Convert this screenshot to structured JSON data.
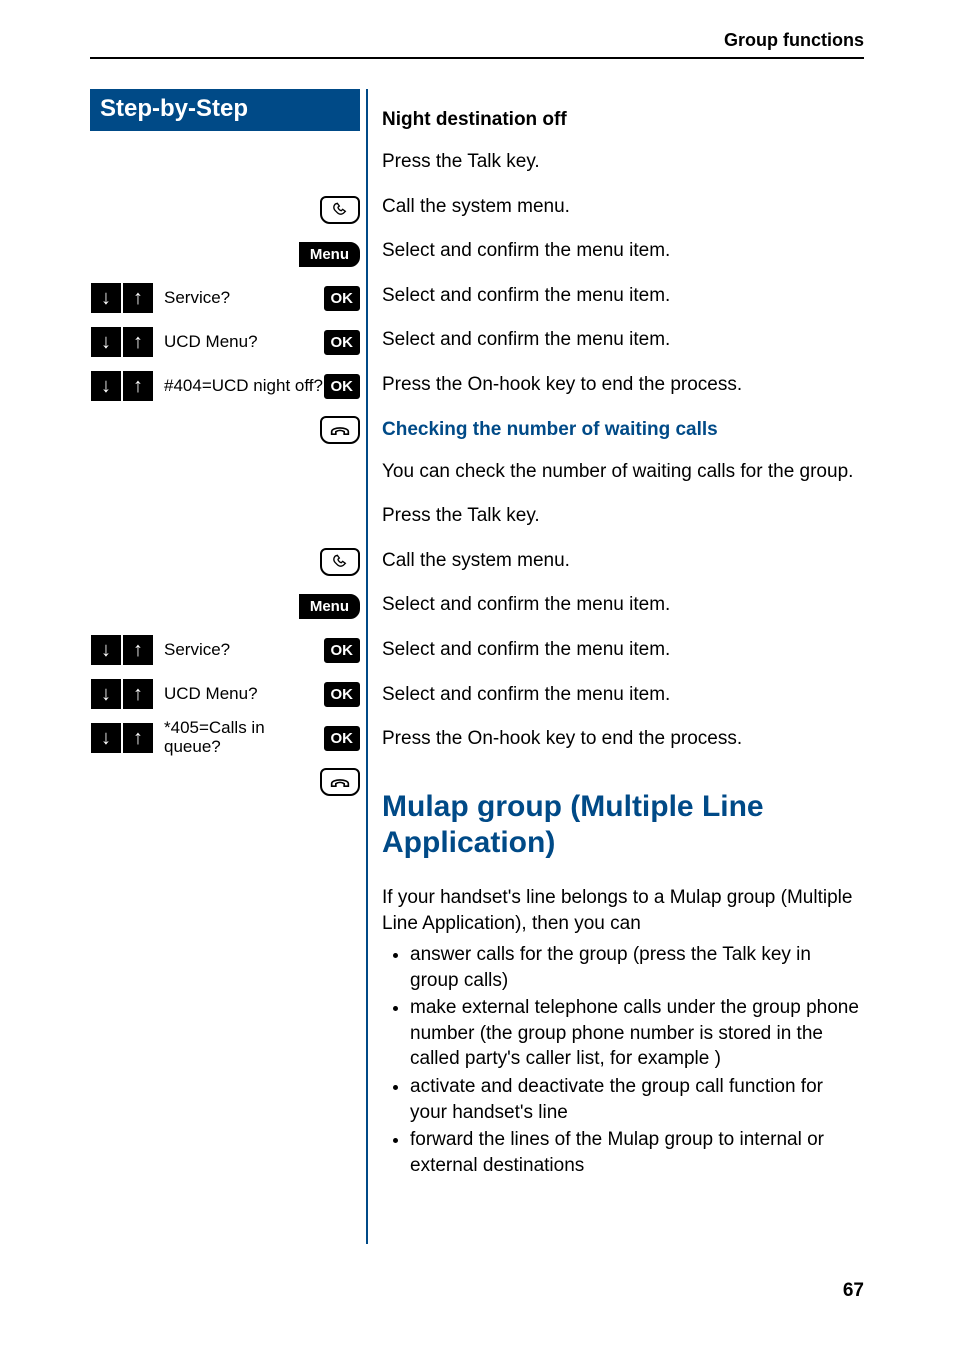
{
  "header_right": "Group functions",
  "sidebar_title": "Step-by-Step",
  "btn": {
    "menu": "Menu",
    "ok": "OK"
  },
  "section1": {
    "heading": "Night destination off",
    "steps": {
      "talk": "Press the Talk key.",
      "menu": "Call the system menu.",
      "service_label": "Service?",
      "service_text": "Select and confirm the menu item.",
      "ucd_label": "UCD Menu?",
      "ucd_text": "Select and confirm the menu item.",
      "night_label": "#404=UCD night off?",
      "night_text": "Select and confirm the menu item.",
      "onhook": "Press the On-hook key to end the process."
    }
  },
  "section2": {
    "heading": "Checking the number of waiting calls",
    "intro": "You can check the number of waiting calls for the group.",
    "steps": {
      "talk": "Press the Talk key.",
      "menu": "Call the system menu.",
      "service_label": "Service?",
      "service_text": "Select and confirm the menu item.",
      "ucd_label": "UCD Menu?",
      "ucd_text": "Select and confirm the menu item.",
      "calls_label": "*405=Calls in queue?",
      "calls_text": "Select and confirm the menu item.",
      "onhook": "Press the On-hook key to end the process."
    }
  },
  "section3": {
    "heading": "Mulap group (Multiple Line Application)",
    "intro": "If your handset's line belongs to a Mulap group (Multiple Line Application), then you can",
    "bullets": [
      "answer calls for the group (press the Talk key in group calls)",
      "make external telephone calls under the group phone number (the group phone number is stored in the called party's caller list, for example )",
      "activate and deactivate the group call function for your handset's line",
      "forward the lines of the Mulap group to internal or external destinations"
    ]
  },
  "page_number": "67"
}
